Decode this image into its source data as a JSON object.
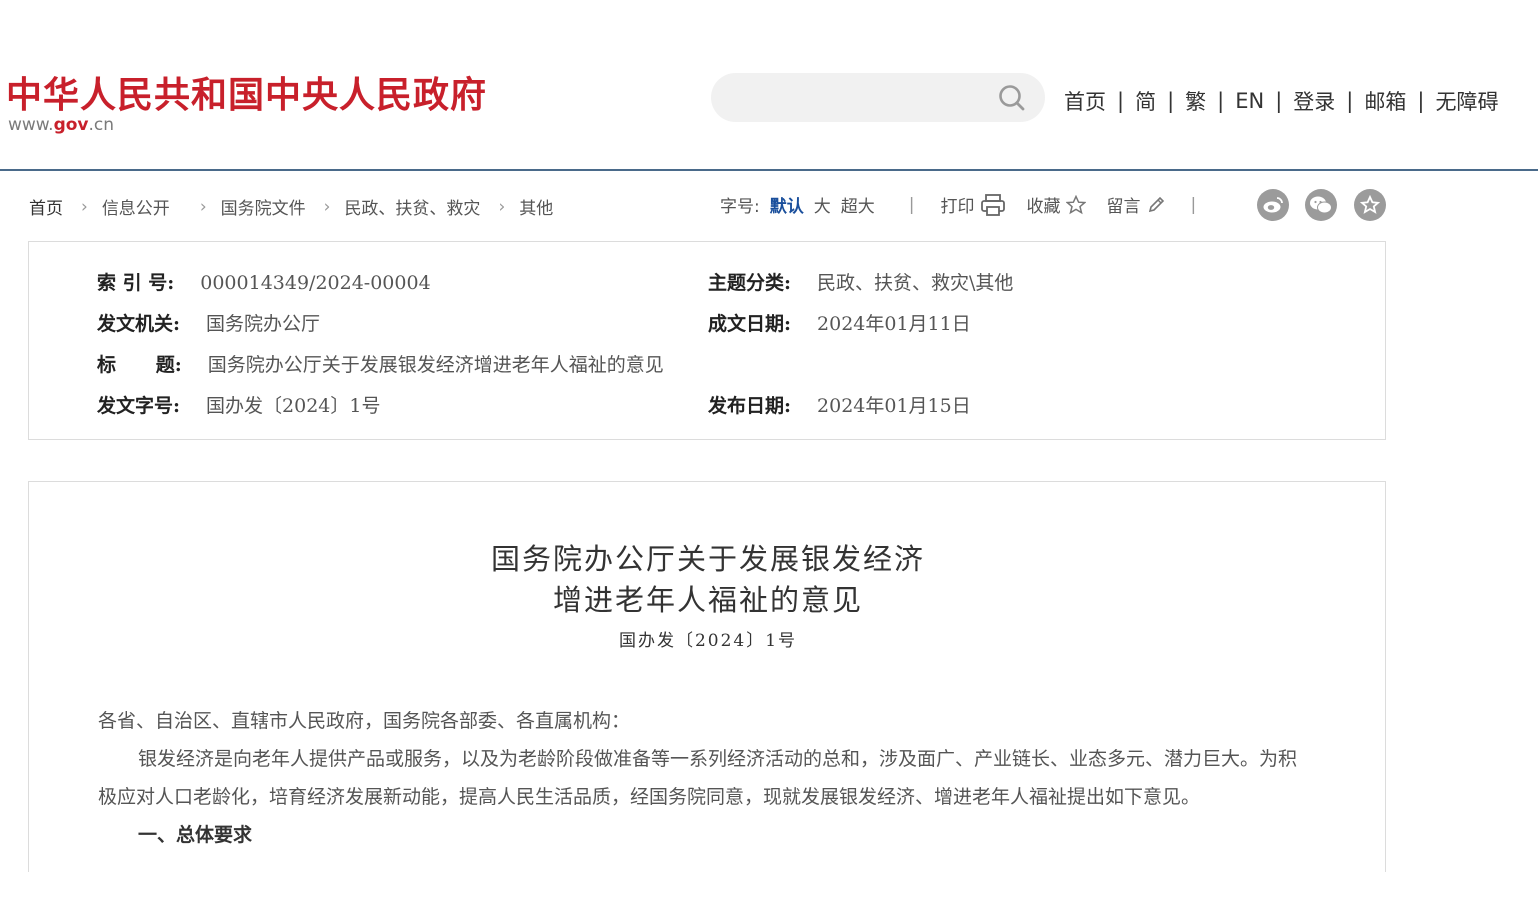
{
  "header": {
    "logo_title": "中华人民共和国中央人民政府",
    "logo_url_pre": "www.",
    "logo_url_mid": "gov",
    "logo_url_post": ".cn",
    "search_placeholder": "",
    "nav": [
      "首页",
      "简",
      "繁",
      "EN",
      "登录",
      "邮箱",
      "无障碍"
    ]
  },
  "breadcrumb": [
    "首页",
    "信息公开",
    "国务院文件",
    "民政、扶贫、救灾",
    "其他"
  ],
  "tools": {
    "font_size_label": "字号:",
    "font_sizes": [
      "默认",
      "大",
      "超大"
    ],
    "print": "打印",
    "favorite": "收藏",
    "comment": "留言"
  },
  "meta": {
    "index_no_label": "索 引 号:",
    "index_no": "000014349/2024-00004",
    "category_label": "主题分类:",
    "category": "民政、扶贫、救灾\\其他",
    "issuer_label": "发文机关:",
    "issuer": "国务院办公厅",
    "date_written_label": "成文日期:",
    "date_written": "2024年01月11日",
    "title_label": "标      题:",
    "title": "国务院办公厅关于发展银发经济增进老年人福祉的意见",
    "doc_no_label": "发文字号:",
    "doc_no": "国办发〔2024〕1号",
    "publish_date_label": "发布日期:",
    "publish_date": "2024年01月15日"
  },
  "article": {
    "title_line1": "国务院办公厅关于发展银发经济",
    "title_line2": "增进老年人福祉的意见",
    "doc_no": "国办发〔2024〕1号",
    "salutation": "各省、自治区、直辖市人民政府，国务院各部委、各直属机构：",
    "para1": "银发经济是向老年人提供产品或服务，以及为老龄阶段做准备等一系列经济活动的总和，涉及面广、产业链长、业态多元、潜力巨大。为积极应对人口老龄化，培育经济发展新动能，提高人民生活品质，经国务院同意，现就发展银发经济、增进老年人福祉提出如下意见。",
    "section1": "一、总体要求"
  }
}
